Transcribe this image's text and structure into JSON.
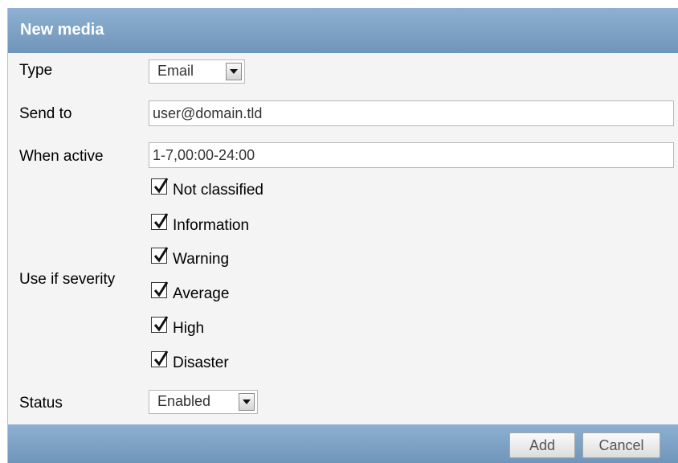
{
  "dialog": {
    "title": "New media",
    "type": {
      "label": "Type",
      "value": "Email"
    },
    "send_to": {
      "label": "Send to",
      "value": "user@domain.tld"
    },
    "when_active": {
      "label": "When active",
      "value": "1-7,00:00-24:00"
    },
    "severity": {
      "label": "Use if severity",
      "options": [
        {
          "label": "Not classified",
          "checked": true
        },
        {
          "label": "Information",
          "checked": true
        },
        {
          "label": "Warning",
          "checked": true
        },
        {
          "label": "Average",
          "checked": true
        },
        {
          "label": "High",
          "checked": true
        },
        {
          "label": "Disaster",
          "checked": true
        }
      ]
    },
    "status": {
      "label": "Status",
      "value": "Enabled"
    },
    "buttons": {
      "add": "Add",
      "cancel": "Cancel"
    }
  },
  "colors": {
    "header_bg": "#7fa3c7",
    "panel_bg": "#f4f4f4"
  }
}
